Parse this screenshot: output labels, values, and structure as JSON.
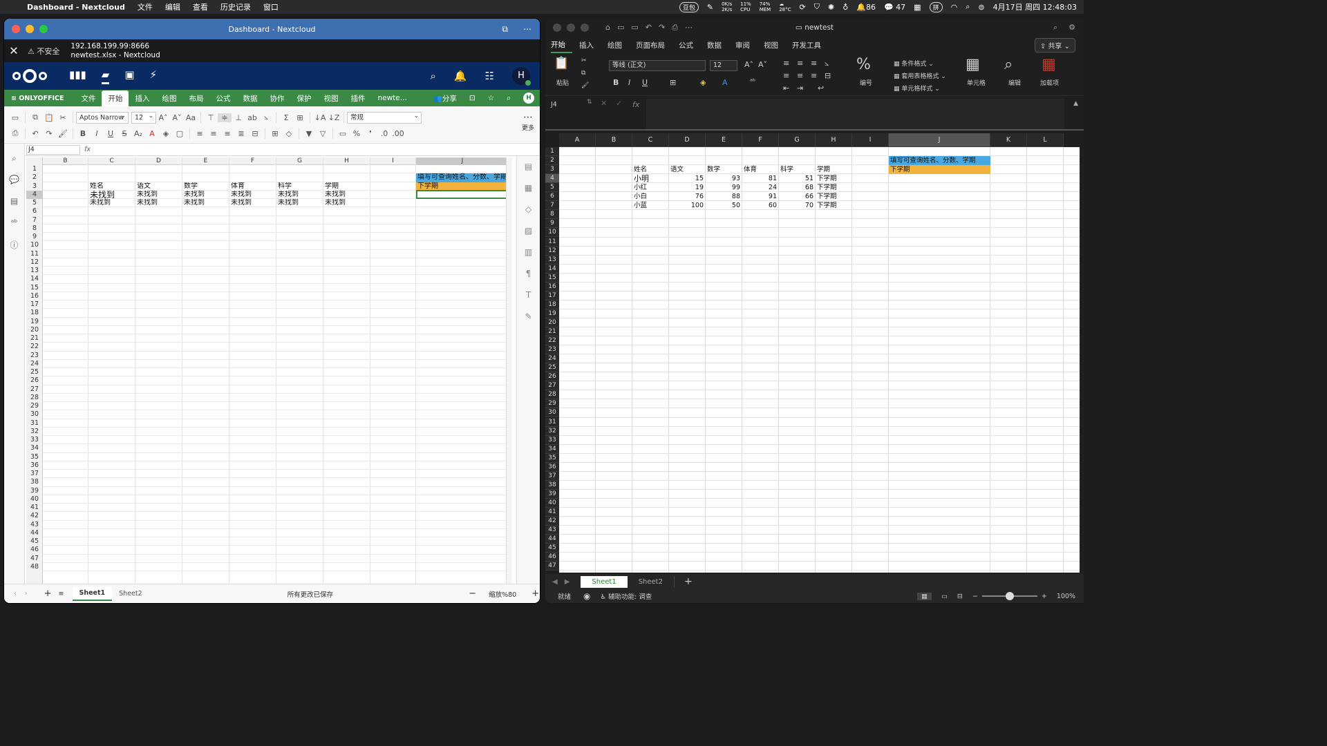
{
  "menubar": {
    "app": "Dashboard - Nextcloud",
    "items": [
      "文件",
      "编辑",
      "查看",
      "历史记录",
      "窗口"
    ],
    "badge_left": "豆包",
    "net_up": "0K/s",
    "net_down": "2K/s",
    "cpu_pct": "11%",
    "cpu_label": "CPU",
    "mem_pct": "74%",
    "mem_label": "MEM",
    "temp": "28°C",
    "notif_count": "86",
    "wechat_count": "47",
    "input_method": "拼",
    "datetime": "4月17日 周四  12:48:03"
  },
  "left": {
    "window_title": "Dashboard - Nextcloud",
    "security": "不安全",
    "url": "192.168.199.99:8666",
    "page_title": "newtest.xlsx - Nextcloud",
    "avatar": "H",
    "oo_brand": "ONLYOFFICE",
    "tabs": [
      "文件",
      "开始",
      "插入",
      "绘图",
      "布局",
      "公式",
      "数据",
      "协作",
      "保护",
      "视图",
      "插件",
      "newte..."
    ],
    "active_tab": "开始",
    "share": "分享",
    "font": "Aptos Narrow",
    "font_size": "12",
    "number_format": "常规",
    "more": "更多",
    "name_box": "J4",
    "fx": "fx",
    "col_headers": [
      "B",
      "C",
      "D",
      "E",
      "F",
      "G",
      "H",
      "I",
      "J"
    ],
    "rows": [
      "1",
      "2",
      "3",
      "4",
      "5",
      "6",
      "7",
      "8",
      "9",
      "10",
      "11",
      "12",
      "13",
      "14",
      "15",
      "16",
      "17",
      "18",
      "19",
      "20",
      "21",
      "22",
      "23",
      "24",
      "25",
      "26",
      "27",
      "28",
      "29",
      "30",
      "31",
      "32",
      "33",
      "34",
      "35",
      "36",
      "37",
      "38",
      "39",
      "40",
      "41",
      "42",
      "43",
      "44",
      "45",
      "46",
      "47",
      "48"
    ],
    "header_row": [
      "姓名",
      "语文",
      "数学",
      "体育",
      "科学",
      "学期"
    ],
    "row4": [
      "未找到",
      "未找到",
      "未找到",
      "未找到",
      "未找到",
      "未找到"
    ],
    "row5": [
      "未找到",
      "未找到",
      "未找到",
      "未找到",
      "未找到",
      "未找到"
    ],
    "j2": "填写可查询姓名、分数、学期",
    "j3": "下学期",
    "sheets": [
      "Sheet1",
      "Sheet2"
    ],
    "status": "所有更改已保存",
    "zoom": "缩放%80"
  },
  "right": {
    "window_title": "newtest",
    "tabs": [
      "开始",
      "插入",
      "绘图",
      "页面布局",
      "公式",
      "数据",
      "审阅",
      "视图",
      "开发工具"
    ],
    "active_tab": "开始",
    "share": "共享",
    "paste": "粘贴",
    "font": "等线 (正文)",
    "font_size": "12",
    "number_label": "编号",
    "cond_format": "条件格式",
    "table_format": "套用表格格式",
    "cell_style": "单元格样式",
    "cells": "单元格",
    "edit": "编辑",
    "addins": "加载项",
    "name_box": "J4",
    "fx": "fx",
    "col_headers": [
      "A",
      "B",
      "C",
      "D",
      "E",
      "F",
      "G",
      "H",
      "I",
      "J",
      "K",
      "L"
    ],
    "rows": [
      "1",
      "2",
      "3",
      "4",
      "5",
      "6",
      "7",
      "8",
      "9",
      "10",
      "11",
      "12",
      "13",
      "14",
      "15",
      "16",
      "17",
      "18",
      "19",
      "20",
      "21",
      "22",
      "23",
      "24",
      "25",
      "26",
      "27",
      "28",
      "29",
      "30",
      "31",
      "32",
      "33",
      "34",
      "35",
      "36",
      "37",
      "38",
      "39",
      "40",
      "41",
      "42",
      "43",
      "44",
      "45",
      "46",
      "47"
    ],
    "header_row": [
      "姓名",
      "语文",
      "数学",
      "体育",
      "科学",
      "学期"
    ],
    "data_rows": [
      [
        "小明",
        "15",
        "93",
        "81",
        "51",
        "下学期"
      ],
      [
        "小红",
        "19",
        "99",
        "24",
        "68",
        "下学期"
      ],
      [
        "小白",
        "76",
        "88",
        "91",
        "66",
        "下学期"
      ],
      [
        "小蓝",
        "100",
        "50",
        "60",
        "70",
        "下学期"
      ]
    ],
    "j2": "填写可查询姓名、分数、学期",
    "j3": "下学期",
    "sheets": [
      "Sheet1",
      "Sheet2"
    ],
    "status_ready": "就绪",
    "accessibility": "辅助功能: 调查",
    "zoom": "100%"
  }
}
